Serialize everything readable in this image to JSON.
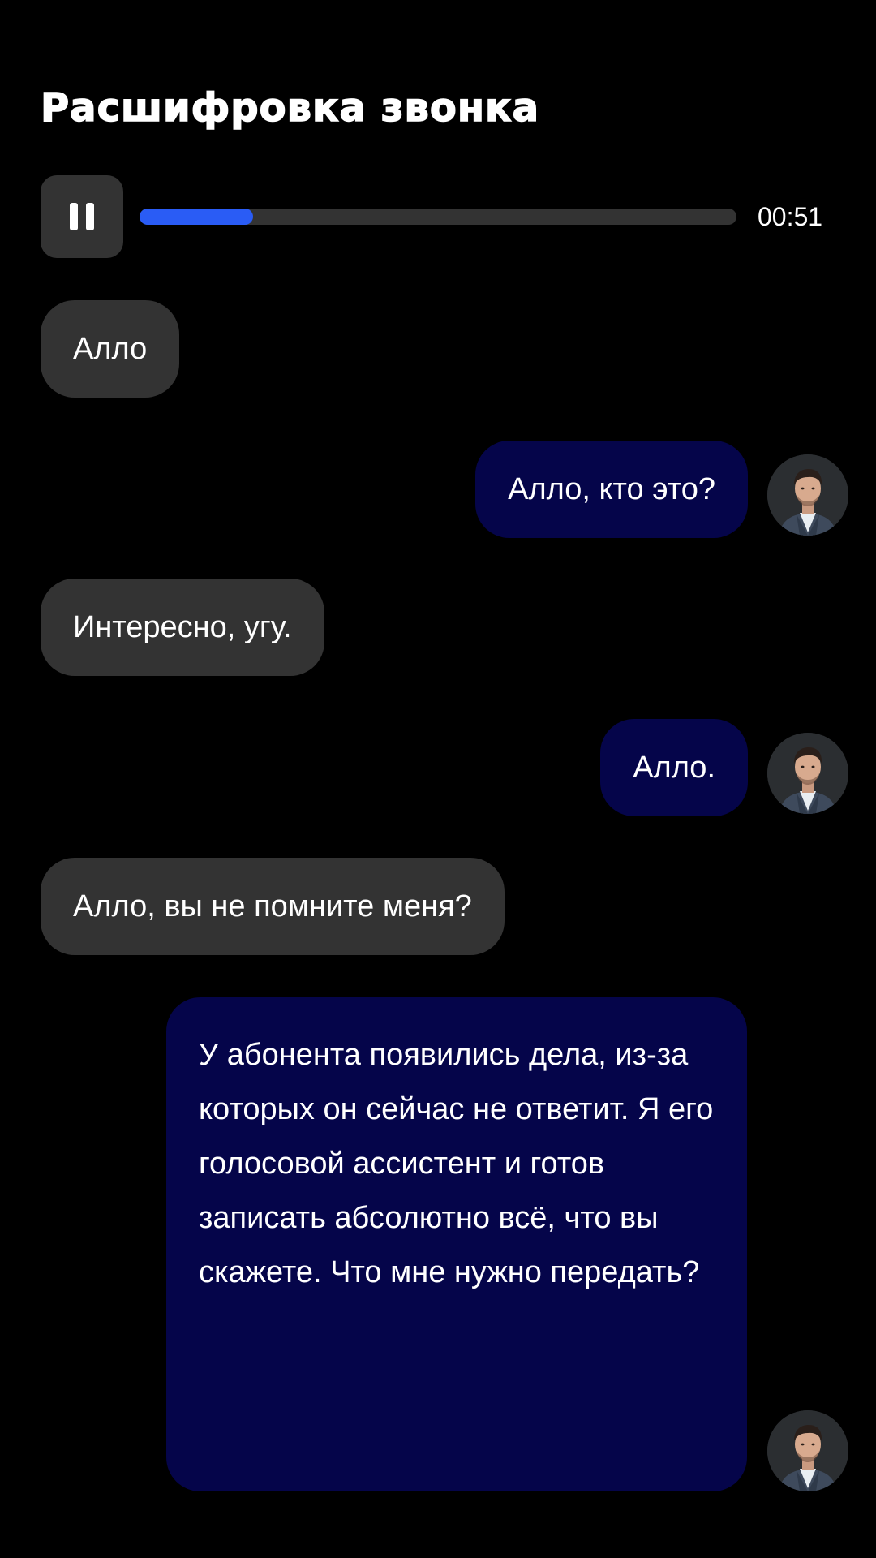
{
  "header": {
    "title": "Расшифровка звонка"
  },
  "player": {
    "state_icon": "pause-icon",
    "progress": 0.19,
    "time": "00:51",
    "accent_color": "#2a5cf5"
  },
  "messages": [
    {
      "side": "incoming",
      "text": "Алло"
    },
    {
      "side": "outgoing",
      "text": "Алло, кто это?"
    },
    {
      "side": "incoming",
      "text": "Интересно, угу."
    },
    {
      "side": "outgoing",
      "text": "Алло."
    },
    {
      "side": "incoming",
      "text": "Алло, вы не помните меня?"
    },
    {
      "side": "outgoing",
      "text": "У абонента появились дела, из-за которых он сейчас не ответит. Я его голосовой ассистент и готов записать абсолютно всё, что вы скажете. Что мне нужно передать?"
    }
  ],
  "colors": {
    "background": "#000000",
    "incoming_bubble": "#333333",
    "outgoing_bubble": "#05054a"
  }
}
